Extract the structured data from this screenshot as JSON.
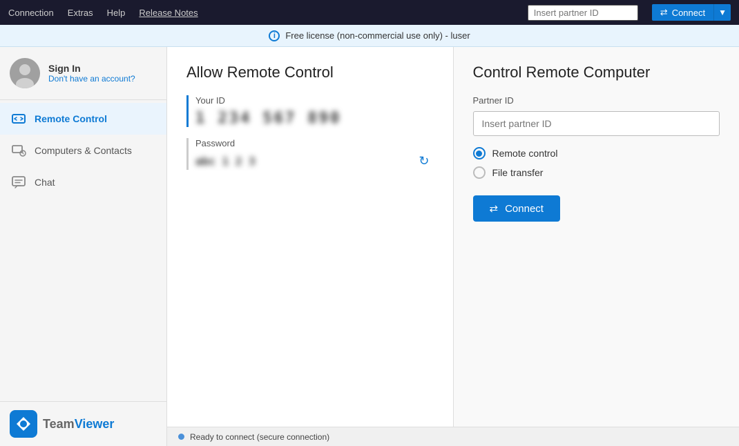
{
  "menubar": {
    "connection": "Connection",
    "extras": "Extras",
    "help": "Help",
    "release_notes": "Release Notes",
    "partner_id_placeholder": "Insert partner ID",
    "connect_label": "Connect"
  },
  "license_banner": {
    "text": "Free license (non-commercial use only) - luser"
  },
  "sidebar": {
    "sign_in": "Sign In",
    "no_account": "Don't have an account?",
    "nav_items": [
      {
        "id": "remote-control",
        "label": "Remote Control",
        "active": true
      },
      {
        "id": "computers-contacts",
        "label": "Computers & Contacts",
        "active": false
      },
      {
        "id": "chat",
        "label": "Chat",
        "active": false
      }
    ],
    "logo_team": "Team",
    "logo_viewer": "Viewer"
  },
  "allow_panel": {
    "title": "Allow Remote Control",
    "your_id_label": "Your ID",
    "your_id_value": "1 234 567 890",
    "password_label": "Password",
    "password_value": "abc 1 2 3"
  },
  "control_panel": {
    "title": "Control Remote Computer",
    "partner_id_label": "Partner ID",
    "partner_id_placeholder": "Insert partner ID",
    "options": [
      {
        "id": "remote-control",
        "label": "Remote control",
        "selected": true
      },
      {
        "id": "file-transfer",
        "label": "File transfer",
        "selected": false
      }
    ],
    "connect_label": "Connect"
  },
  "status_bar": {
    "text": "Ready to connect (secure connection)"
  }
}
